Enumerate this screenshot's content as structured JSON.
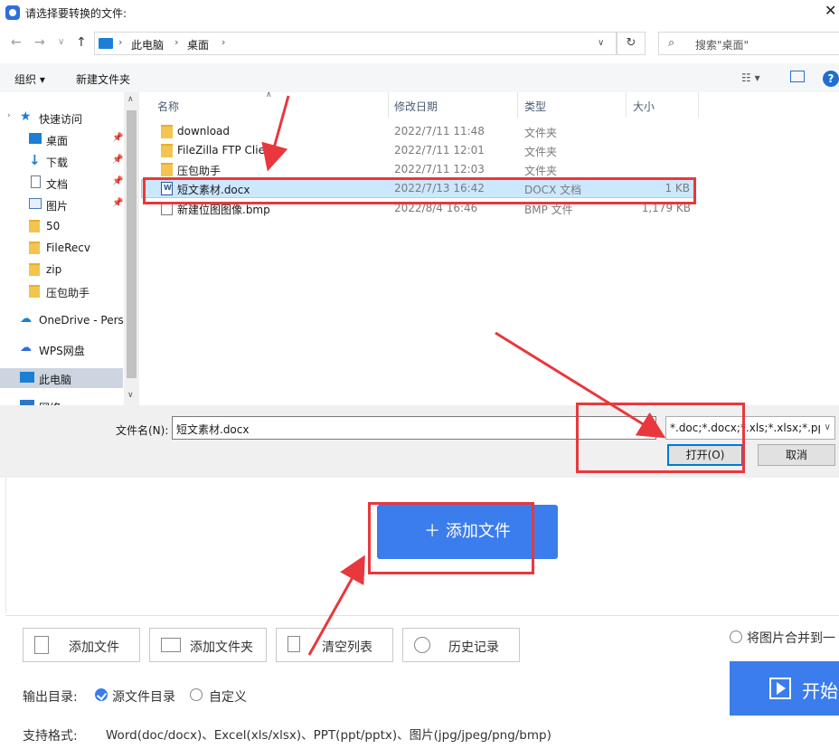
{
  "dialog": {
    "title": "请选择要转换的文件:",
    "close": "✕",
    "breadcrumb": [
      "此电脑",
      "桌面"
    ],
    "search_placeholder": "搜索\"桌面\"",
    "toolbar": {
      "organize": "组织 ▾",
      "new_folder": "新建文件夹",
      "help": "?"
    },
    "nav_items": [
      {
        "label": "快速访问",
        "icon": "star-icon"
      },
      {
        "label": "桌面",
        "icon": "desktop-icon",
        "pinned": true
      },
      {
        "label": "下载",
        "icon": "download-icon",
        "pinned": true
      },
      {
        "label": "文档",
        "icon": "document-icon",
        "pinned": true
      },
      {
        "label": "图片",
        "icon": "picture-icon",
        "pinned": true
      },
      {
        "label": "50",
        "icon": "folder-icon"
      },
      {
        "label": "FileRecv",
        "icon": "folder-icon"
      },
      {
        "label": "zip",
        "icon": "folder-icon"
      },
      {
        "label": "压包助手",
        "icon": "folder-icon"
      },
      {
        "label": "OneDrive - Perso",
        "icon": "cloud-icon"
      },
      {
        "label": "WPS网盘",
        "icon": "cloud-icon"
      },
      {
        "label": "此电脑",
        "icon": "computer-icon",
        "selected": true
      },
      {
        "label": "网络",
        "icon": "network-icon"
      }
    ],
    "columns": {
      "name": "名称",
      "date": "修改日期",
      "type": "类型",
      "size": "大小"
    },
    "files": [
      {
        "name": "download",
        "date": "2022/7/11 11:48",
        "type": "文件夹",
        "size": "",
        "icon": "folder-icon"
      },
      {
        "name": "FileZilla FTP Client",
        "date": "2022/7/11 12:01",
        "type": "文件夹",
        "size": "",
        "icon": "folder-icon"
      },
      {
        "name": "压包助手",
        "date": "2022/7/11 12:03",
        "type": "文件夹",
        "size": "",
        "icon": "folder-icon"
      },
      {
        "name": "短文素材.docx",
        "date": "2022/7/13 16:42",
        "type": "DOCX 文档",
        "size": "1 KB",
        "icon": "docx-icon",
        "selected": true
      },
      {
        "name": "新建位图图像.bmp",
        "date": "2022/8/4 16:46",
        "type": "BMP 文件",
        "size": "1,179 KB",
        "icon": "bmp-icon"
      }
    ],
    "filename_label": "文件名(N):",
    "filename_value": "短文素材.docx",
    "filter_value": "*.doc;*.docx;*.xls;*.xlsx;*.ppt;*",
    "open_label": "打开(O)",
    "cancel_label": "取消"
  },
  "app": {
    "add_file_big": "＋ 添加文件",
    "buttons": {
      "add_file": "添加文件",
      "add_folder": "添加文件夹",
      "clear_list": "清空列表",
      "history": "历史记录"
    },
    "merge_images_label": "将图片合并到一",
    "output_dir_label": "输出目录:",
    "source_dir_label": "源文件目录",
    "custom_label": "自定义",
    "formats_label": "支持格式:",
    "formats_value": "Word(doc/docx)、Excel(xls/xlsx)、PPT(ppt/pptx)、图片(jpg/jpeg/png/bmp)",
    "start_label": "开始",
    "accent_color": "#3b7ded"
  },
  "annotation_color": "#e8383d"
}
